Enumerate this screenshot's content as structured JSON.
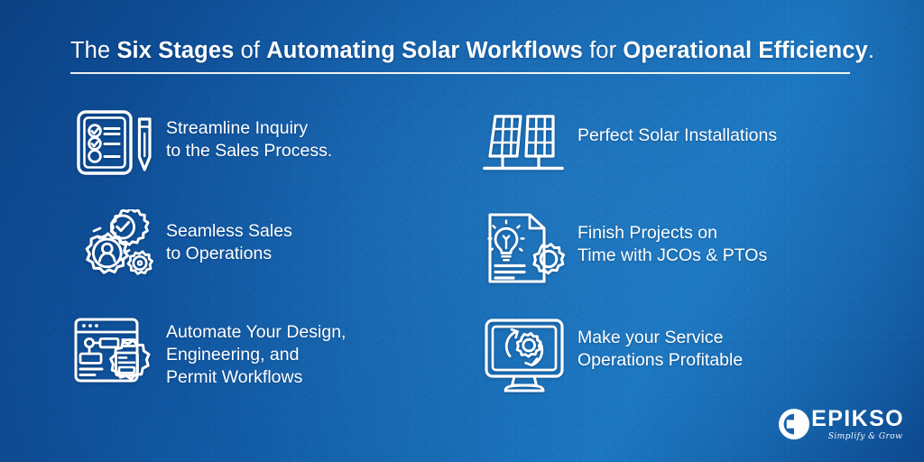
{
  "theme": {
    "bg_dark_blue": "#0c4489",
    "bg_mid_blue": "#1668b2",
    "bg_light_blue": "#1a74bf",
    "foreground": "#ffffff"
  },
  "header": {
    "title_parts": [
      {
        "text": "The ",
        "bold": false
      },
      {
        "text": "Six Stages",
        "bold": true
      },
      {
        "text": " of ",
        "bold": false
      },
      {
        "text": "Automating Solar Workflows",
        "bold": true
      },
      {
        "text": " for ",
        "bold": false
      },
      {
        "text": "Operational Efficiency",
        "bold": true
      },
      {
        "text": ".",
        "bold": false
      }
    ],
    "title_plain": "The Six Stages of Automating Solar Workflows for Operational Efficiency."
  },
  "stages": [
    {
      "id": "streamline-inquiry",
      "icon": "clipboard-checklist-pencil-icon",
      "text": "Streamline Inquiry\nto the Sales Process."
    },
    {
      "id": "perfect-solar-installations",
      "icon": "solar-panels-icon",
      "text": "Perfect Solar Installations"
    },
    {
      "id": "seamless-sales-to-operations",
      "icon": "gears-person-check-icon",
      "text": "Seamless Sales\nto Operations"
    },
    {
      "id": "finish-projects-on-time",
      "icon": "document-lightbulb-gear-icon",
      "text": "Finish Projects on\nTime with JCOs & PTOs"
    },
    {
      "id": "automate-design-engineering-permit",
      "icon": "browser-flowchart-certificate-icon",
      "text": "Automate Your Design,\nEngineering, and\nPermit Workflows"
    },
    {
      "id": "make-service-operations-profitable",
      "icon": "monitor-gear-refresh-icon",
      "text": "Make your Service\nOperations Profitable"
    }
  ],
  "logo": {
    "mark": "epikso-circle-e-mark",
    "word": "EPIKSO",
    "tagline": "Simplify & Grow"
  }
}
